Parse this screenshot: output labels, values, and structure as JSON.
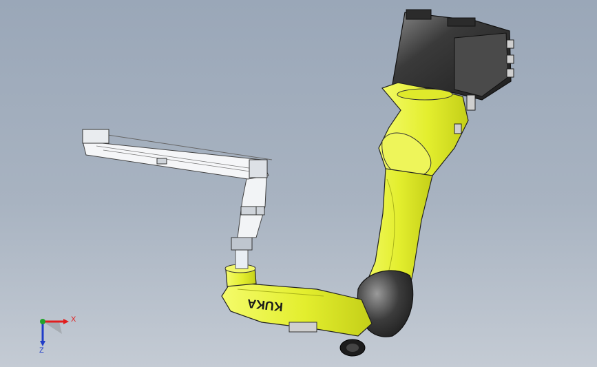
{
  "viewport": {
    "background_top": "#9aa7b8",
    "background_bottom": "#c4cbd4"
  },
  "model": {
    "brand_label": "KUKA",
    "body_color": "#e6f03a",
    "joint_color": "#3b3b3b",
    "outline_color": "#1a1a1a"
  },
  "triad": {
    "x_label": "X",
    "z_label": "Z",
    "x_color": "#e11d1d",
    "y_color": "#22a32a",
    "z_color": "#1f3cc8"
  }
}
